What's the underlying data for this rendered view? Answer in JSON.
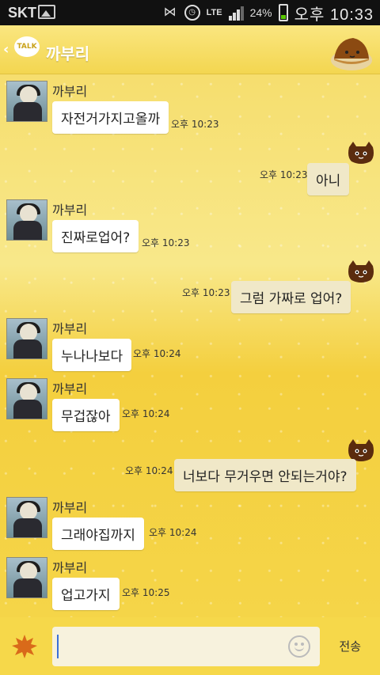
{
  "status_bar": {
    "carrier": "SKT",
    "lte": "LTE",
    "battery_percent": "24%",
    "time": "오후 10:33"
  },
  "header": {
    "logo": "TALK",
    "title": "까부리"
  },
  "messages": [
    {
      "dir": "in",
      "sender": "까부리",
      "text": "자전거가지고올까",
      "time": "오후 10:23"
    },
    {
      "dir": "out",
      "text": "아니",
      "time": "오후 10:23"
    },
    {
      "dir": "in",
      "sender": "까부리",
      "text": "진짜로업어?",
      "time": "오후 10:23"
    },
    {
      "dir": "out",
      "text": "그럼 가짜로 업어?",
      "time": "오후 10:23"
    },
    {
      "dir": "in",
      "sender": "까부리",
      "text": "누나나보다",
      "time": "오후 10:24"
    },
    {
      "dir": "in",
      "sender": "까부리",
      "text": "무겁잖아",
      "time": "오후 10:24"
    },
    {
      "dir": "out",
      "text": "너보다 무거우면 안되는거야?",
      "time": "오후 10:24"
    },
    {
      "dir": "in",
      "sender": "까부리",
      "text": "그래야집까지",
      "time": "오후 10:24"
    },
    {
      "dir": "in",
      "sender": "까부리",
      "text": "업고가지",
      "time": "오후 10:25"
    }
  ],
  "input": {
    "value": "",
    "send_label": "전송"
  },
  "colors": {
    "bubble_out": "#f0e8c8",
    "bubble_in": "#ffffff",
    "background": "#f7d84a"
  },
  "icons": [
    "gallery-icon",
    "mute-icon",
    "alarm-icon",
    "signal-icon",
    "battery-icon",
    "back-icon",
    "talk-logo-icon",
    "chestnut-icon",
    "cat-sticker-icon",
    "leaf-icon",
    "emoticon-icon"
  ]
}
